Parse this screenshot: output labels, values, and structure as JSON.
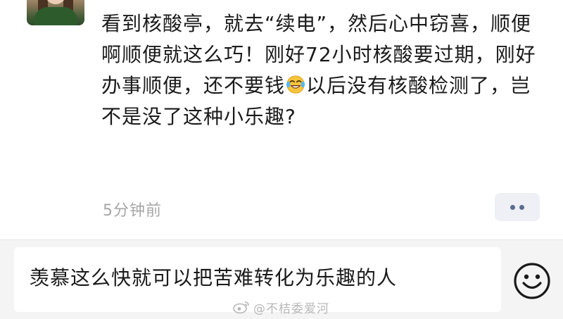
{
  "post": {
    "text_before_emoji": "看到核酸亭，就去“续电”，然后心中窃喜，顺便啊顺便就这么巧！刚好72小时核酸要过期，刚好办事顺便，还不要钱",
    "emoji": "laughing-tears-emoji",
    "text_after_emoji": "以后没有核酸检测了，岂不是没了这种小乐趣?",
    "timestamp": "5分钟前",
    "more_icon": "more-dots-icon"
  },
  "composer": {
    "input_value": "羡慕这么快就可以把苦难转化为乐趣的人",
    "emoji_button_icon": "smiley-icon"
  },
  "watermark": {
    "text": "@不桔委爱河",
    "icon": "weibo-logo-icon"
  },
  "colors": {
    "text": "#1a1a1a",
    "timestamp": "#a6a6a6",
    "composer_bg": "#f4f4f4",
    "more_button_bg": "#eef0f6",
    "more_dots": "#5a6c8f"
  }
}
